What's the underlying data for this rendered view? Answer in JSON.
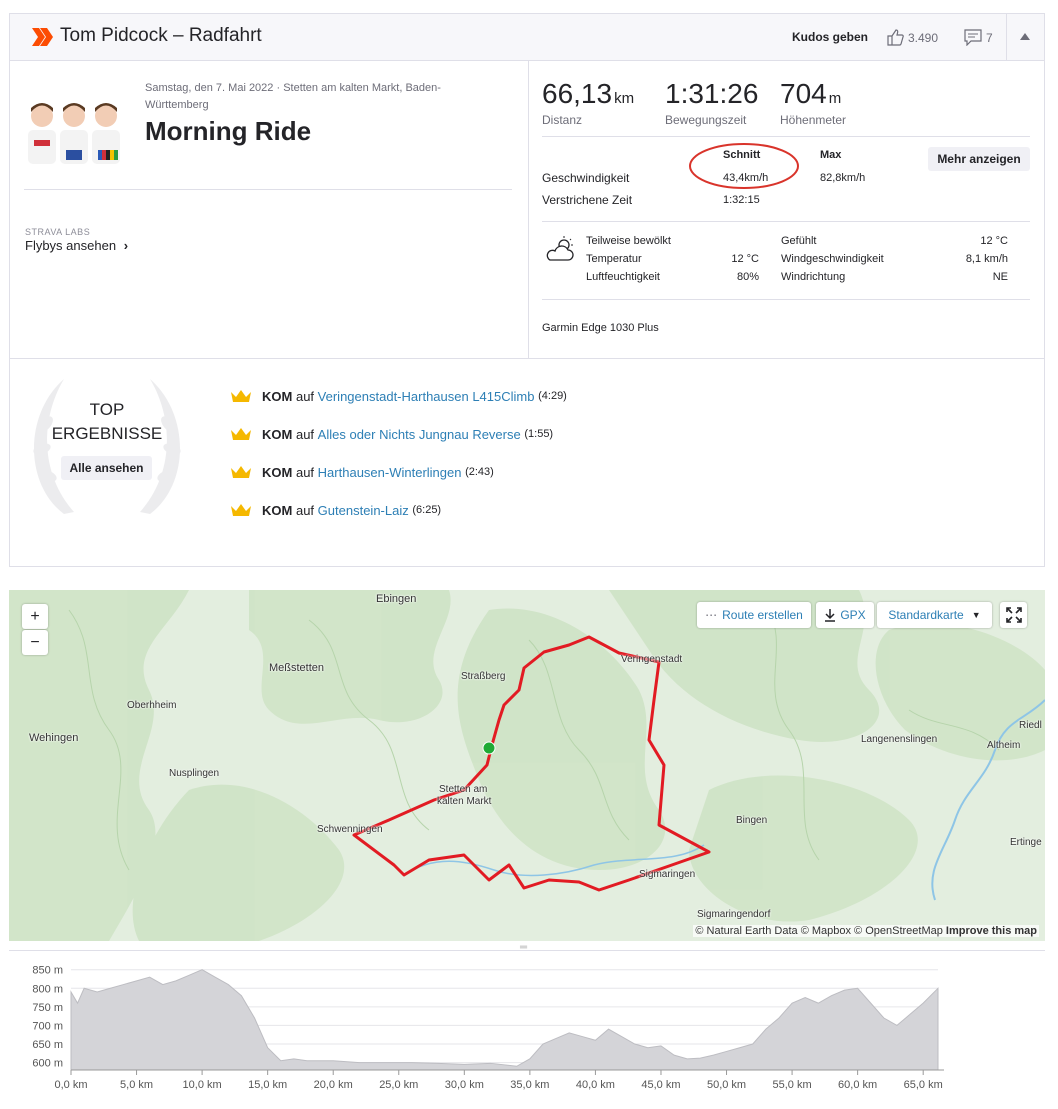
{
  "header": {
    "title": "Tom Pidcock – Radfahrt",
    "kudos_label": "Kudos geben",
    "kudos_count": "3.490",
    "comments_count": "7"
  },
  "activity": {
    "date_location": "Samstag, den 7. Mai 2022 · Stetten am kalten Markt, Baden-Württemberg",
    "name": "Morning Ride",
    "labs_label": "STRAVA LABS",
    "flybys_label": "Flybys ansehen"
  },
  "stats": {
    "distance_value": "66,13",
    "distance_unit": "km",
    "distance_label": "Distanz",
    "moving_time_value": "1:31:26",
    "moving_time_label": "Bewegungszeit",
    "elevation_value": "704",
    "elevation_unit": "m",
    "elevation_label": "Höhenmeter"
  },
  "speed_table": {
    "avg_header": "Schnitt",
    "max_header": "Max",
    "more_button": "Mehr anzeigen",
    "speed_label": "Geschwindigkeit",
    "speed_avg": "43,4km/h",
    "speed_max": "82,8km/h",
    "elapsed_label": "Verstrichene Zeit",
    "elapsed_value": "1:32:15"
  },
  "weather": {
    "condition": "Teilweise bewölkt",
    "temp_label": "Temperatur",
    "temp_value": "12 °C",
    "humidity_label": "Luftfeuchtigkeit",
    "humidity_value": "80%",
    "feels_label": "Gefühlt",
    "feels_value": "12 °C",
    "wind_speed_label": "Windgeschwindigkeit",
    "wind_speed_value": "8,1 km/h",
    "wind_dir_label": "Windrichtung",
    "wind_dir_value": "NE"
  },
  "device": "Garmin Edge 1030 Plus",
  "top_results": {
    "title_line1": "TOP",
    "title_line2": "ERGEBNISSE",
    "all_button": "Alle ansehen",
    "items": [
      {
        "badge": "KOM",
        "on": "auf",
        "segment": "Veringenstadt-Harthausen L415Climb",
        "time": "(4:29)"
      },
      {
        "badge": "KOM",
        "on": "auf",
        "segment": "Alles oder Nichts Jungnau Reverse",
        "time": "(1:55)"
      },
      {
        "badge": "KOM",
        "on": "auf",
        "segment": "Harthausen-Winterlingen",
        "time": "(2:43)"
      },
      {
        "badge": "KOM",
        "on": "auf",
        "segment": "Gutenstein-Laiz",
        "time": "(6:25)"
      }
    ]
  },
  "map": {
    "zoom_in": "+",
    "zoom_out": "−",
    "route_button": "Route erstellen",
    "gpx_button": "GPX",
    "map_type": "Standardkarte",
    "attribution": "© Natural Earth Data © Mapbox © OpenStreetMap",
    "improve": "Improve this map",
    "places": [
      {
        "name": "Ebingen"
      },
      {
        "name": "Meßstetten"
      },
      {
        "name": "Straßberg"
      },
      {
        "name": "Veringenstadt"
      },
      {
        "name": "Oberhheim"
      },
      {
        "name": "Wehingen"
      },
      {
        "name": "Nusplingen"
      },
      {
        "name": "Stetten am"
      },
      {
        "name": "kalten Markt"
      },
      {
        "name": "Schwenningen"
      },
      {
        "name": "Bingen"
      },
      {
        "name": "Langenenslingen"
      },
      {
        "name": "Altheim"
      },
      {
        "name": "Riedl"
      },
      {
        "name": "Ertinge"
      },
      {
        "name": "Sigmaringen"
      },
      {
        "name": "Sigmaringendorf"
      }
    ]
  },
  "chart_data": {
    "type": "area",
    "xlabel": "",
    "ylabel": "",
    "ylim": [
      580,
      860
    ],
    "xlim": [
      0,
      66.13
    ],
    "y_ticks": [
      "850 m",
      "800 m",
      "750 m",
      "700 m",
      "650 m",
      "600 m"
    ],
    "y_tick_values": [
      850,
      800,
      750,
      700,
      650,
      600
    ],
    "x_ticks": [
      "0,0 km",
      "5,0 km",
      "10,0 km",
      "15,0 km",
      "20,0 km",
      "25,0 km",
      "30,0 km",
      "35,0 km",
      "40,0 km",
      "45,0 km",
      "50,0 km",
      "55,0 km",
      "60,0 km",
      "65,0 km"
    ],
    "x_tick_values": [
      0,
      5,
      10,
      15,
      20,
      25,
      30,
      35,
      40,
      45,
      50,
      55,
      60,
      65
    ],
    "x": [
      0,
      0.5,
      1,
      2,
      3,
      4,
      5,
      6,
      7,
      8,
      9,
      10,
      11,
      12,
      13,
      14,
      15,
      16,
      17,
      18,
      20,
      22,
      24,
      26,
      28,
      30,
      32,
      34,
      35,
      36,
      37,
      38,
      39,
      40,
      41,
      42,
      43,
      44,
      45,
      46,
      47,
      48,
      49,
      50,
      51,
      52,
      53,
      54,
      55,
      56,
      57,
      58,
      59,
      60,
      61,
      62,
      63,
      64,
      65,
      66.13
    ],
    "y": [
      790,
      760,
      800,
      790,
      800,
      810,
      820,
      830,
      810,
      820,
      835,
      850,
      830,
      810,
      780,
      720,
      640,
      605,
      610,
      605,
      605,
      600,
      600,
      600,
      598,
      595,
      598,
      590,
      610,
      650,
      665,
      680,
      670,
      660,
      690,
      670,
      650,
      640,
      645,
      620,
      610,
      612,
      620,
      630,
      640,
      650,
      690,
      720,
      760,
      775,
      760,
      780,
      795,
      800,
      760,
      720,
      700,
      730,
      760,
      800
    ]
  }
}
